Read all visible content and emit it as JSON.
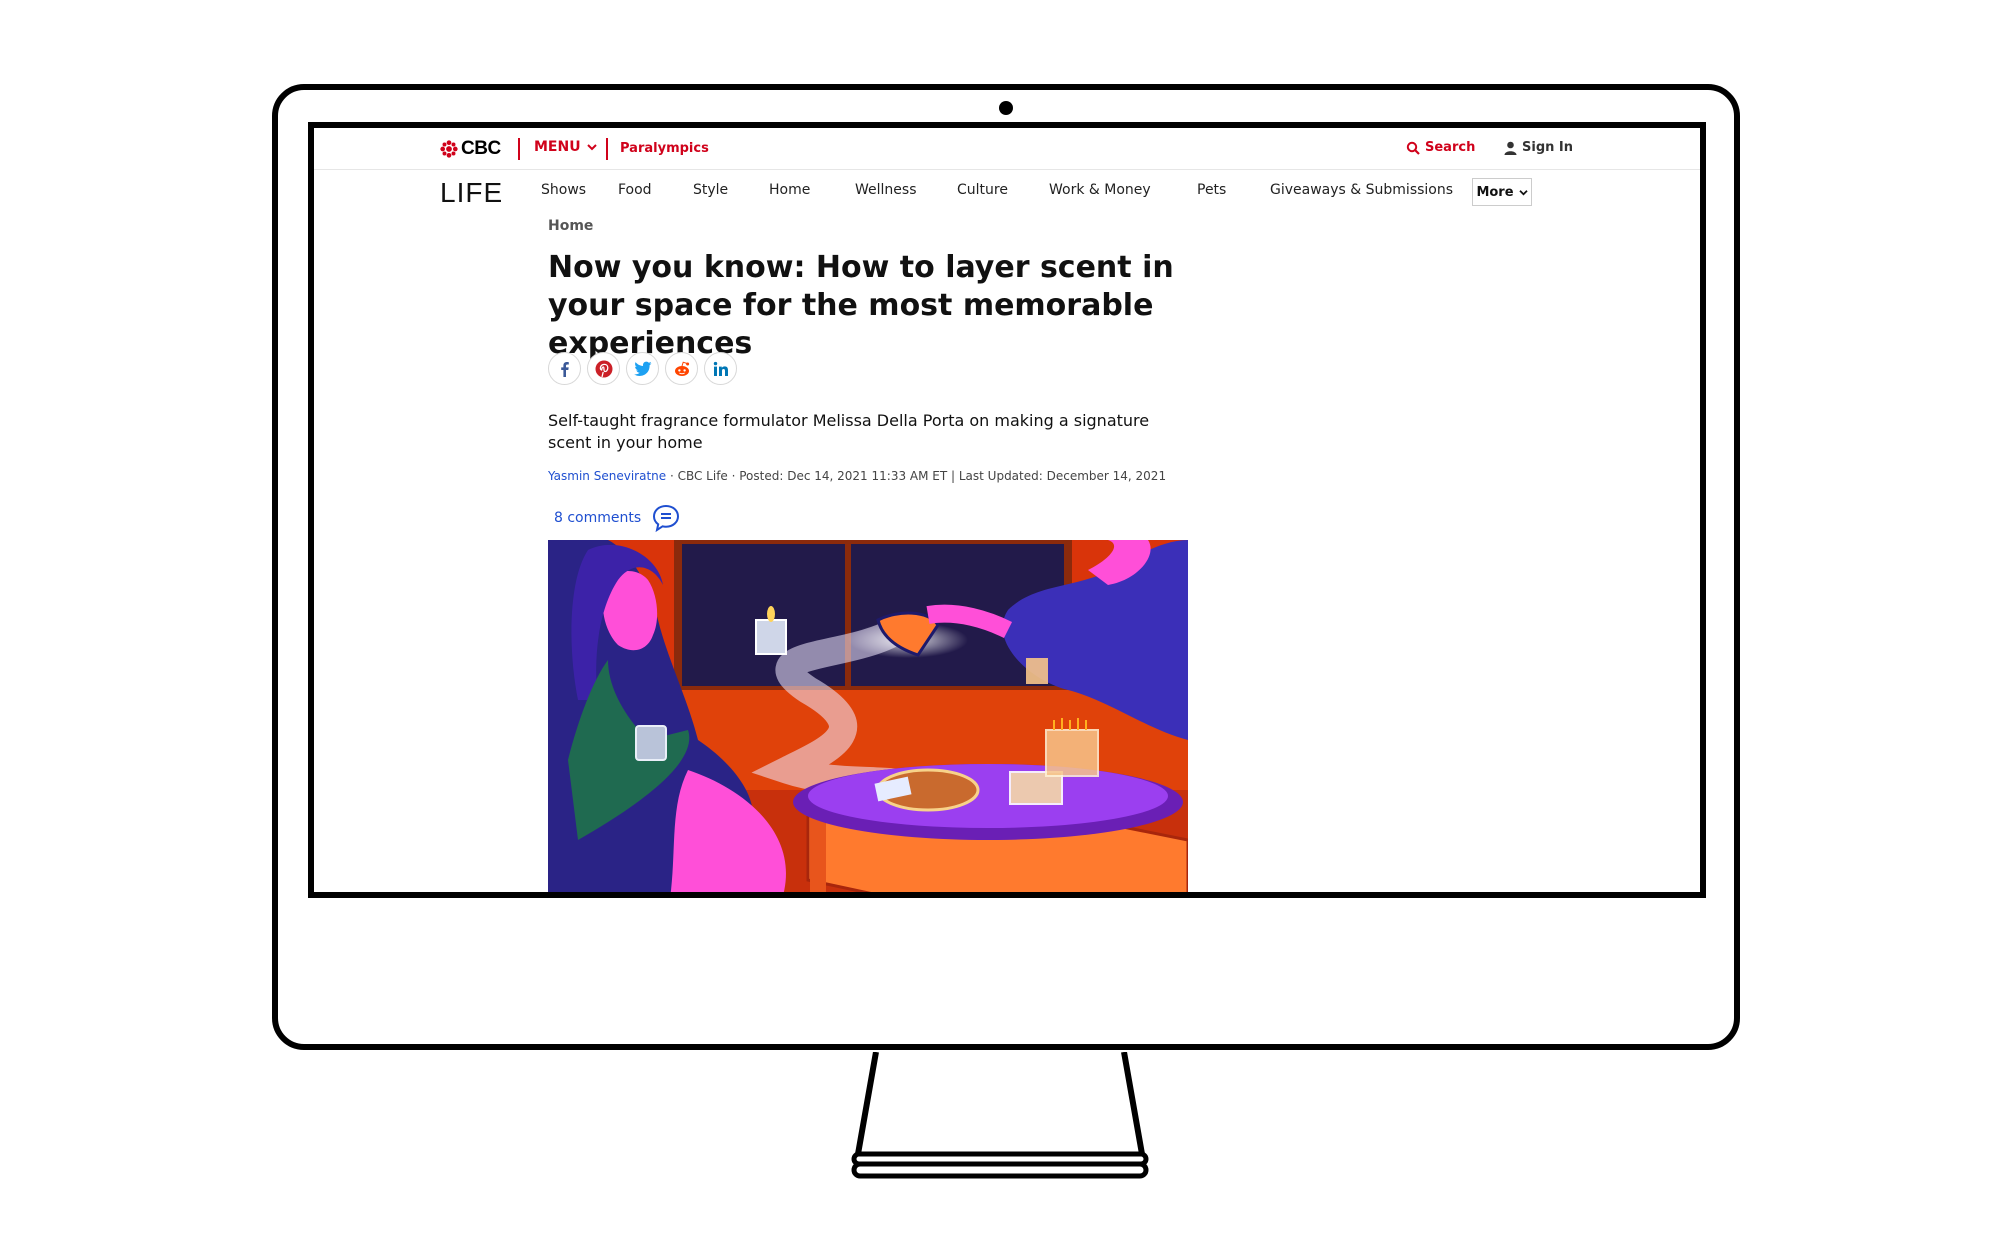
{
  "topbar": {
    "logo_text": "CBC",
    "menu_label": "MENU",
    "paralympics_label": "Paralympics",
    "search_label": "Search",
    "signin_label": "Sign In"
  },
  "nav": {
    "section_logo": "LIFE",
    "items": [
      {
        "label": "Shows"
      },
      {
        "label": "Food"
      },
      {
        "label": "Style"
      },
      {
        "label": "Home"
      },
      {
        "label": "Wellness"
      },
      {
        "label": "Culture"
      },
      {
        "label": "Work & Money"
      },
      {
        "label": "Pets"
      },
      {
        "label": "Giveaways & Submissions"
      }
    ],
    "more_label": "More"
  },
  "article": {
    "breadcrumb": "Home",
    "headline": "Now you know: How to layer scent in your space for the most memorable experiences",
    "share_icons": [
      "facebook-icon",
      "pinterest-icon",
      "twitter-icon",
      "reddit-icon",
      "linkedin-icon"
    ],
    "deck": "Self-taught fragrance formulator Melissa Della Porta on making a signature scent in your home",
    "author": "Yasmin Seneviratne",
    "byline_rest": " · CBC Life · Posted: Dec 14, 2021 11:33 AM ET | Last Updated: December 14, 2021",
    "comments_label": "8 comments"
  },
  "colors": {
    "brand_red": "#d0021b",
    "link_blue": "#1f4fd0"
  }
}
